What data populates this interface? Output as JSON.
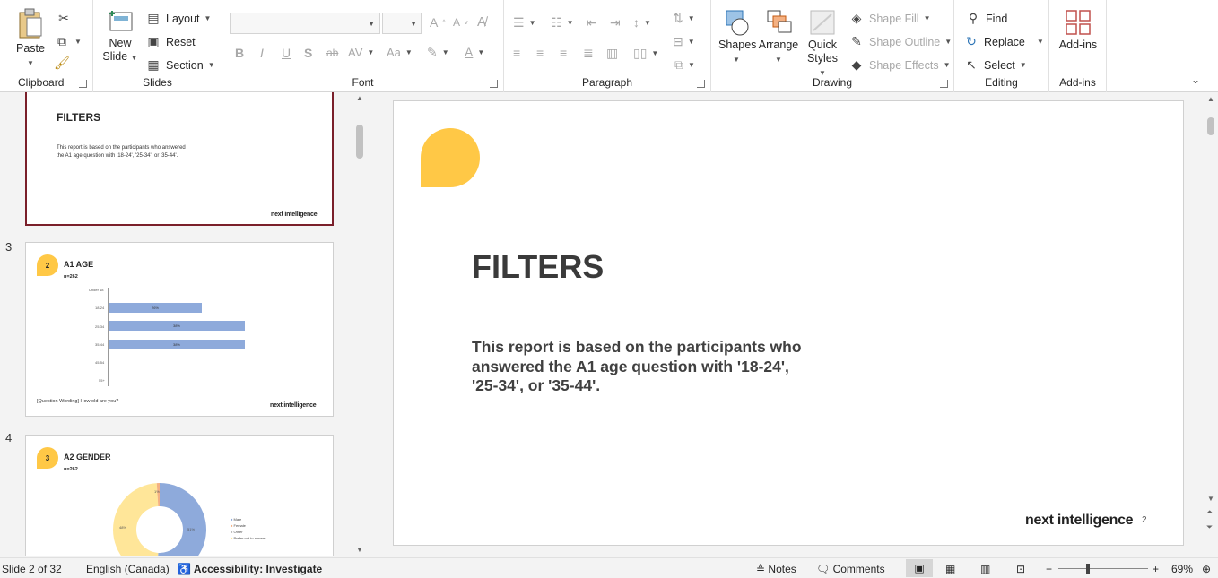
{
  "ribbon": {
    "clipboard": {
      "paste": "Paste",
      "label": "Clipboard"
    },
    "slides": {
      "new_slide_line1": "New",
      "new_slide_line2": "Slide",
      "layout": "Layout",
      "reset": "Reset",
      "section": "Section",
      "label": "Slides"
    },
    "font": {
      "label": "Font"
    },
    "paragraph": {
      "label": "Paragraph"
    },
    "drawing": {
      "shapes": "Shapes",
      "arrange": "Arrange",
      "quick_line1": "Quick",
      "quick_line2": "Styles",
      "shape_fill": "Shape Fill",
      "shape_outline": "Shape Outline",
      "shape_effects": "Shape Effects",
      "label": "Drawing"
    },
    "editing": {
      "find": "Find",
      "replace": "Replace",
      "select": "Select",
      "label": "Editing"
    },
    "addins": {
      "button": "Add-ins",
      "label": "Add-ins"
    }
  },
  "thumbnails": {
    "slide2": {
      "title": "FILTERS",
      "body": "This report is based on the participants who answered the A1 age question with '18-24', '25-34', or '35-44'.",
      "logo": "next intelligence"
    },
    "slide3": {
      "number": "3",
      "badge": "2",
      "title": "A1 AGE",
      "n": "n=262",
      "axis": [
        "Under 18",
        "18-24",
        "25-34",
        "35-44",
        "45-54",
        "55+"
      ],
      "bars": [
        {
          "label": "26%",
          "value": 26
        },
        {
          "label": "38%",
          "value": 38
        },
        {
          "label": "38%",
          "value": 38
        }
      ],
      "wording": "[Question Wording] How old are you?",
      "logo": "next intelligence"
    },
    "slide4": {
      "number": "4",
      "badge": "3",
      "title": "A2 GENDER",
      "n": "n=262",
      "legend": [
        "Male",
        "Female",
        "Other",
        "Prefer not to answer"
      ],
      "slices": [
        {
          "label": "51%",
          "value": 51
        },
        {
          "label": "48%",
          "value": 48
        },
        {
          "label": "1%",
          "value": 1
        }
      ]
    }
  },
  "slide": {
    "title": "FILTERS",
    "body": "This report is based on the participants who answered the A1 age question with '18-24', '25-34', or '35-44'.",
    "logo": "next intelligence",
    "page": "2"
  },
  "status": {
    "slide_count": "Slide 2 of 32",
    "language": "English (Canada)",
    "accessibility": "Accessibility: Investigate",
    "notes": "Notes",
    "comments": "Comments",
    "zoom": "69%"
  },
  "colors": {
    "accent_yellow": "#ffc846",
    "selection": "#7a1f2a",
    "bar_blue": "#8eaadb",
    "donut_yellow": "#ffe699",
    "icon_red": "#c0504d"
  }
}
